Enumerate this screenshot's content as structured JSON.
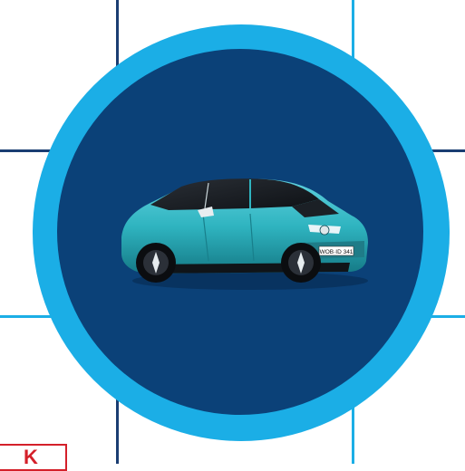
{
  "colors": {
    "background": "#ffffff",
    "grid_line": "#1a3d72",
    "grid_line_light": "#1baee6",
    "ring": "#1baee6",
    "disk": "#0b4178",
    "car_body": "#2fb4c0",
    "badge_border": "#d4202a"
  },
  "car": {
    "plate_text": "WOB·ID 341"
  },
  "corner_logo": {
    "glyph": "K"
  }
}
